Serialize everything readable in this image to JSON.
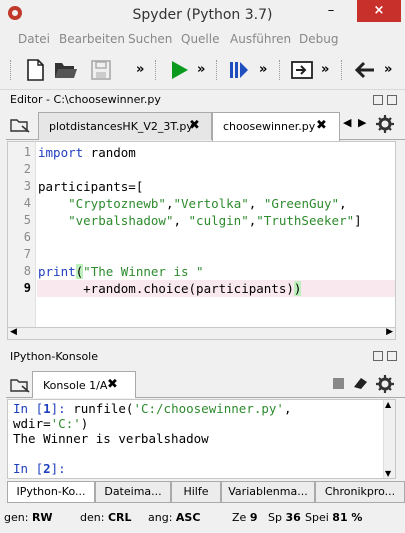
{
  "window": {
    "title": "Spyder (Python 3.7)",
    "minimize": "–",
    "close": "×"
  },
  "menu": [
    "Datei",
    "Bearbeiten",
    "Suchen",
    "Quelle",
    "Ausführen",
    "Debug"
  ],
  "toolbar": {
    "more": "»"
  },
  "editor": {
    "title": "Editor - C:\\choosewinner.py",
    "tabs": [
      {
        "label": "plotdistancesHK_V2_3T.py",
        "close": "✖"
      },
      {
        "label": "choosewinner.py",
        "close": "✖"
      }
    ],
    "lines": [
      {
        "n": "1",
        "code": "import random"
      },
      {
        "n": "2",
        "code": ""
      },
      {
        "n": "3",
        "code": "participants=["
      },
      {
        "n": "4",
        "code": "    \"Cryptoznewb\",\"Vertolka\", \"GreenGuy\","
      },
      {
        "n": "5",
        "code": "    \"verbalshadow\", \"culgin\",\"TruthSeeker\"]"
      },
      {
        "n": "6",
        "code": ""
      },
      {
        "n": "7",
        "code": ""
      },
      {
        "n": "8",
        "code": "print(\"The Winner is \""
      },
      {
        "n": "9",
        "code": "      +random.choice(participants))"
      }
    ],
    "current_line": "9"
  },
  "console": {
    "title": "IPython-Konsole",
    "tab": {
      "label": "Konsole 1/A",
      "close": "✖"
    },
    "lines": [
      "In [1]: runfile('C:/choosewinner.py',",
      "wdir='C:')",
      "The Winner is verbalshadow",
      "",
      "In [2]:"
    ]
  },
  "bottom_tabs": [
    "IPython-Ko...",
    "Dateima...",
    "Hilfe",
    "Variablenma...",
    "Chronikpro..."
  ],
  "status": {
    "perm_label": "gen:",
    "perm_value": "RW",
    "eol_label": "den:",
    "eol_value": "CRL",
    "enc_label": "ang:",
    "enc_value": "ASC",
    "line_label": "Ze",
    "line_value": "9",
    "col_label": "Sp",
    "col_value": "36",
    "mem_label": "Spei",
    "mem_value": "81 %"
  },
  "colors": {
    "keyword": "#1f3fbf",
    "string": "#2e8b2e",
    "current_line": "#f9e9ef",
    "run": "#0a9a1e",
    "debug": "#1f4fbf"
  }
}
